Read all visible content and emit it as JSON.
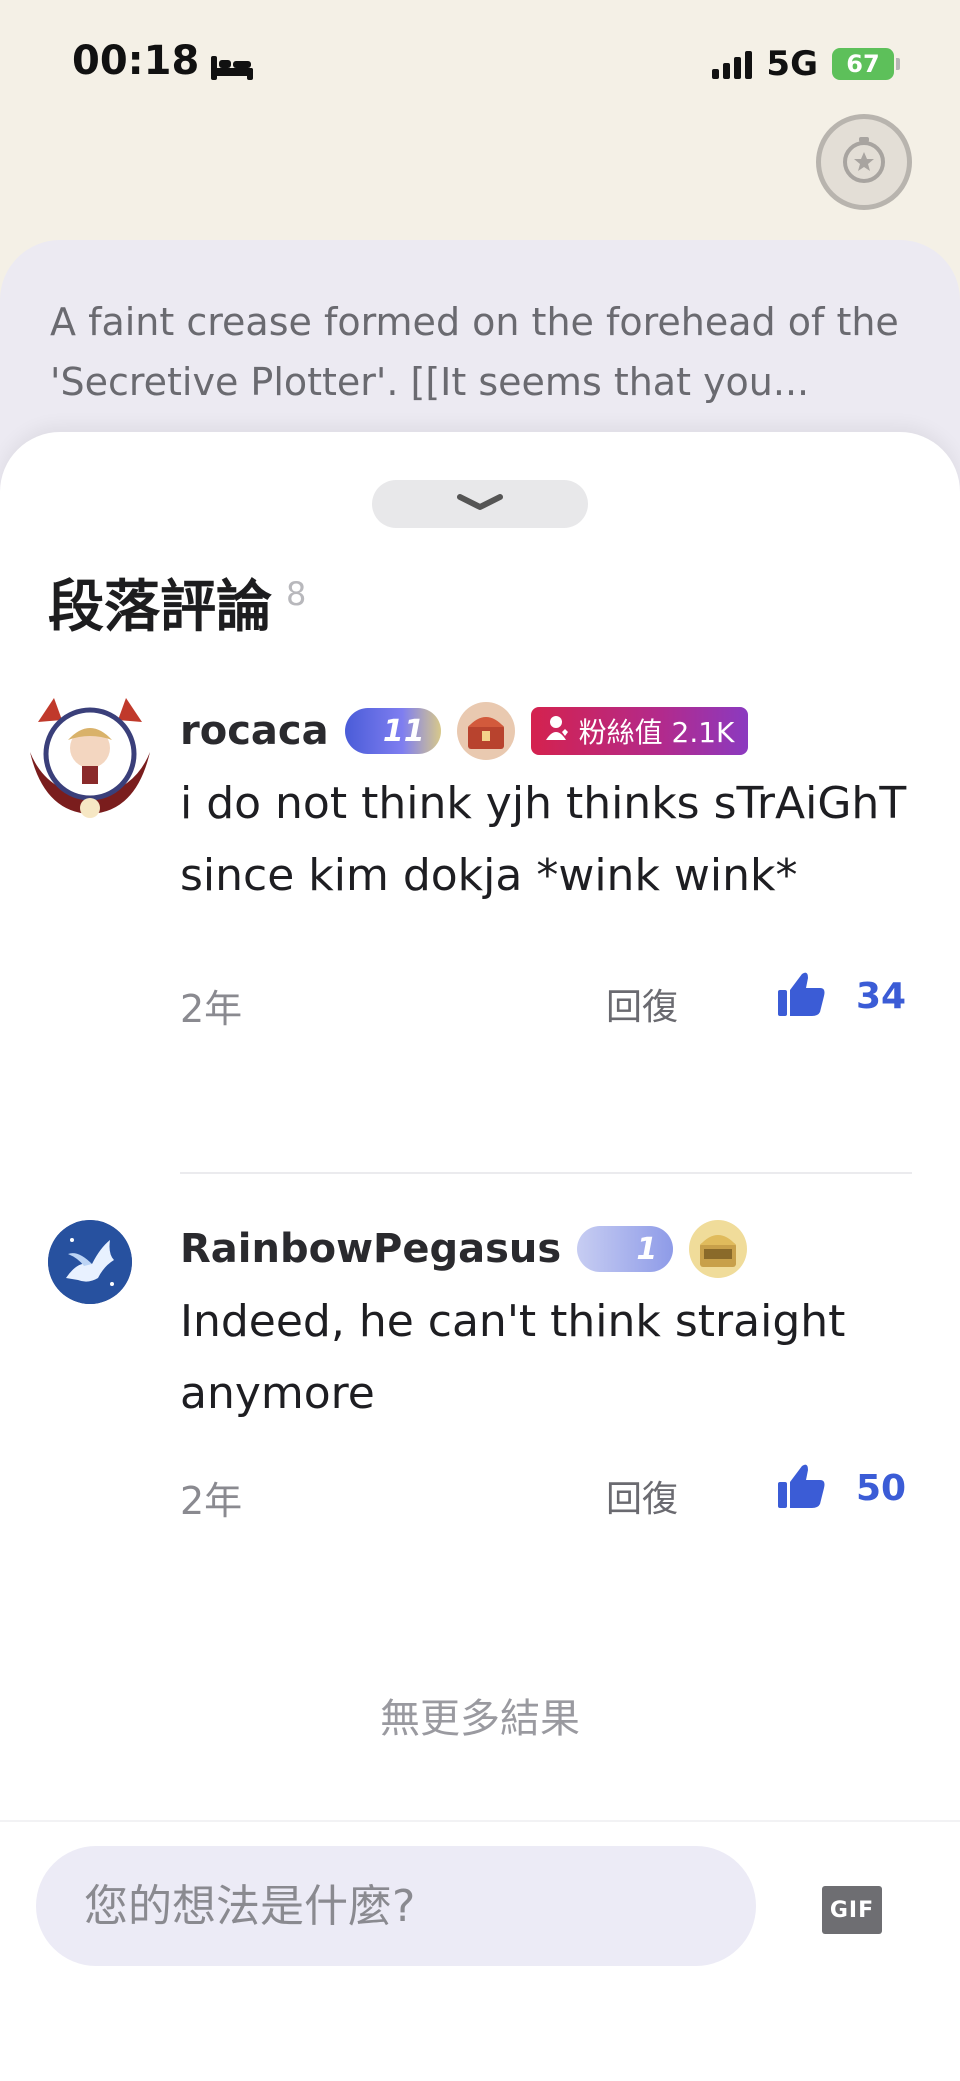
{
  "status_bar": {
    "time": "00:18",
    "network": "5G",
    "battery": "67"
  },
  "paragraph": {
    "text": "A faint crease formed on the forehead of the 'Secretive Plotter'. [[It seems that you..."
  },
  "sheet": {
    "title": "段落評論",
    "count": "8"
  },
  "comments": [
    {
      "username": "rocaca",
      "level": "11",
      "fan_label": "粉絲值 2.1K",
      "text": "i do not think yjh thinks sTrAiGhT since kim dokja *wink wink*",
      "time": "2年",
      "reply_label": "回復",
      "likes": "34"
    },
    {
      "username": "RainbowPegasus",
      "level": "1",
      "text": "Indeed, he can't think straight anymore",
      "time": "2年",
      "reply_label": "回復",
      "likes": "50"
    }
  ],
  "no_more_results": "無更多結果",
  "input": {
    "placeholder": "您的想法是什麼?"
  },
  "gif_label": "GIF",
  "colors": {
    "accent_blue": "#3b5cd6",
    "background": "#f4f0e6",
    "input_bg": "#ecebf6"
  }
}
